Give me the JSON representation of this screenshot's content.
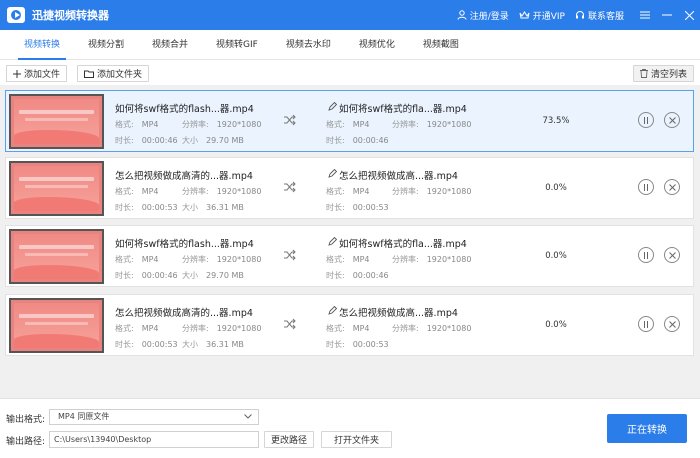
{
  "app": {
    "title": "迅捷视频转换器"
  },
  "header": {
    "login": "注册/登录",
    "vip": "开通VIP",
    "support": "联系客服"
  },
  "tabs": [
    {
      "label": "视频转换",
      "active": true
    },
    {
      "label": "视频分割"
    },
    {
      "label": "视频合并"
    },
    {
      "label": "视频转GIF"
    },
    {
      "label": "视频去水印"
    },
    {
      "label": "视频优化"
    },
    {
      "label": "视频截图"
    }
  ],
  "toolbar": {
    "add_file": "添加文件",
    "add_folder": "添加文件夹",
    "clear_list": "清空列表"
  },
  "labels": {
    "format": "格式:",
    "resolution": "分辨率:",
    "duration": "时长:",
    "size": "大小"
  },
  "files": [
    {
      "name": "如何将swf格式的flash...器.mp4",
      "out_name": "如何将swf格式的fla...器.mp4",
      "format": "MP4",
      "resolution": "1920*1080",
      "duration": "00:00:46",
      "size": "29.70 MB",
      "progress": "73.5%",
      "selected": true
    },
    {
      "name": "怎么把视频做成高清的...器.mp4",
      "out_name": "怎么把视频做成高...器.mp4",
      "format": "MP4",
      "resolution": "1920*1080",
      "duration": "00:00:53",
      "size": "36.31 MB",
      "progress": "0.0%"
    },
    {
      "name": "如何将swf格式的flash...器.mp4",
      "out_name": "如何将swf格式的fla...器.mp4",
      "format": "MP4",
      "resolution": "1920*1080",
      "duration": "00:00:46",
      "size": "29.70 MB",
      "progress": "0.0%"
    },
    {
      "name": "怎么把视频做成高清的...器.mp4",
      "out_name": "怎么把视频做成高...器.mp4",
      "format": "MP4",
      "resolution": "1920*1080",
      "duration": "00:00:53",
      "size": "36.31 MB",
      "progress": "0.0%"
    }
  ],
  "bottom": {
    "output_format_label": "输出格式:",
    "output_format_value": "MP4  同原文件",
    "output_path_label": "输出路径:",
    "output_path_value": "C:\\Users\\13940\\Desktop",
    "change_path": "更改路径",
    "open_folder": "打开文件夹",
    "start": "正在转换"
  },
  "colors": {
    "accent": "#2b7de9",
    "thumb": "#f08a85"
  }
}
